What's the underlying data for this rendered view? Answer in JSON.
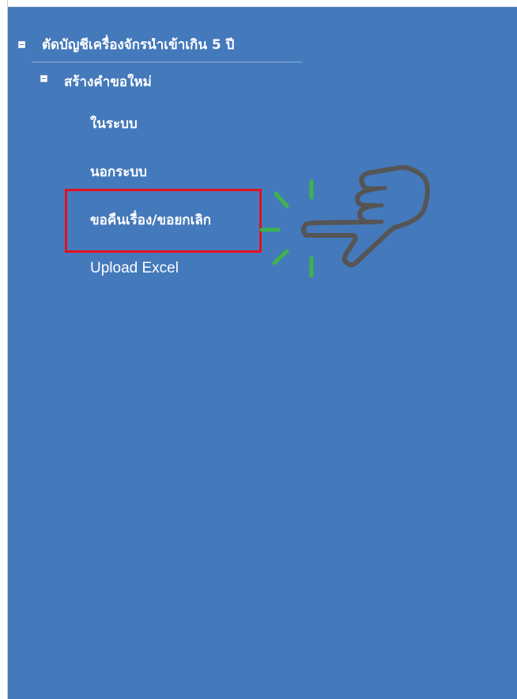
{
  "tree": {
    "root": {
      "label": "ตัดบัญชีเครื่องจักรนำเข้าเกิน 5 ปี",
      "expanded": true
    },
    "child": {
      "label": "สร้างคำขอใหม่",
      "expanded": true
    },
    "items": [
      {
        "label": "ในระบบ"
      },
      {
        "label": "นอกระบบ"
      },
      {
        "label": "ขอคืนเรื่อง/ขอยกเลิก",
        "highlighted": true
      },
      {
        "label": "Upload Excel"
      }
    ]
  },
  "colors": {
    "panel_bg": "#4479bb",
    "text": "#ffffff",
    "highlight": "#e3101a",
    "hand_outline": "#555555",
    "click_rays": "#3fb34f"
  },
  "icons": {
    "pointer": "pointing-hand-icon",
    "click": "click-burst-icon"
  }
}
